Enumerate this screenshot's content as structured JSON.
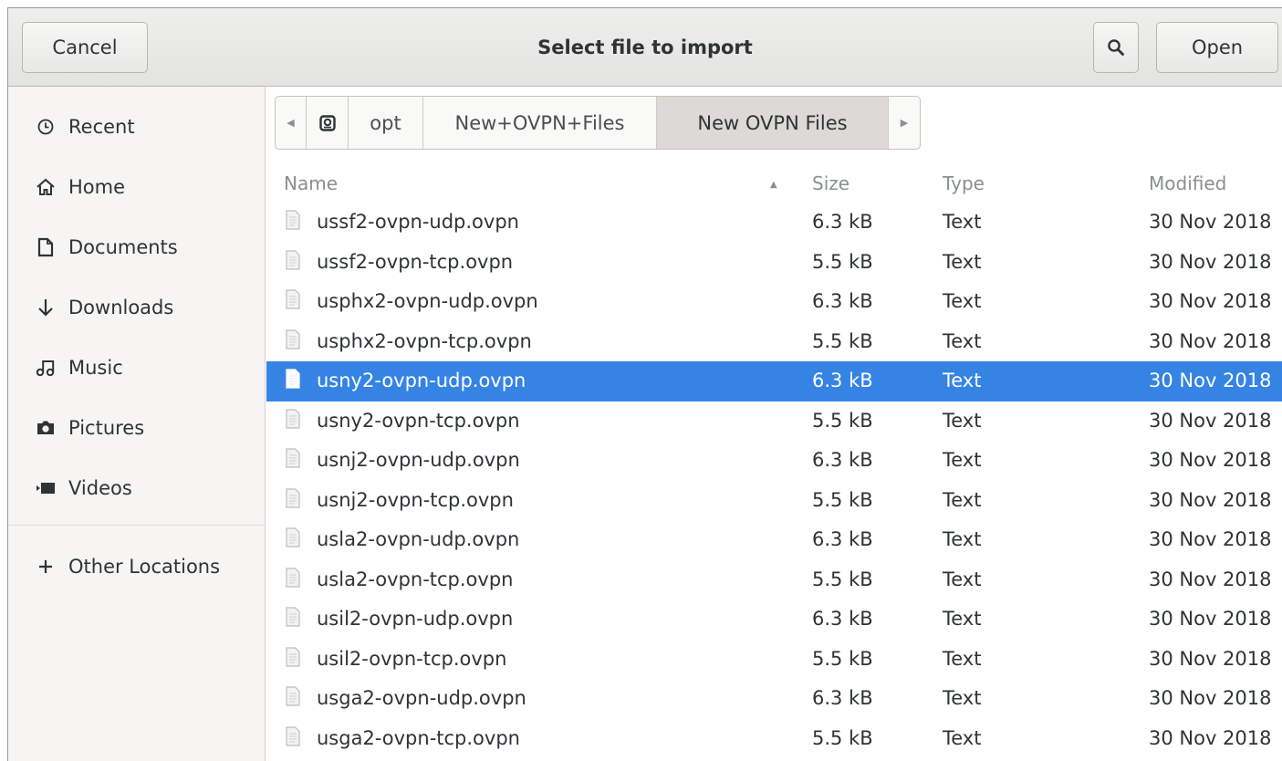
{
  "header": {
    "cancel_label": "Cancel",
    "title": "Select file to import",
    "search_icon": "search-icon",
    "open_label": "Open"
  },
  "sidebar": {
    "items": [
      {
        "label": "Recent",
        "icon": "clock-icon"
      },
      {
        "label": "Home",
        "icon": "home-icon"
      },
      {
        "label": "Documents",
        "icon": "document-icon"
      },
      {
        "label": "Downloads",
        "icon": "download-icon"
      },
      {
        "label": "Music",
        "icon": "music-icon"
      },
      {
        "label": "Pictures",
        "icon": "camera-icon"
      },
      {
        "label": "Videos",
        "icon": "video-icon"
      }
    ],
    "other": {
      "label": "Other Locations",
      "icon": "plus-icon"
    }
  },
  "pathbar": {
    "segments": [
      "opt",
      "New+OVPN+Files",
      "New OVPN Files"
    ],
    "root_icon": "drive-icon"
  },
  "columns": {
    "name": "Name",
    "size": "Size",
    "type": "Type",
    "modified": "Modified"
  },
  "files": [
    {
      "name": "ussf2-ovpn-udp.ovpn",
      "size": "6.3 kB",
      "type": "Text",
      "modified": "30 Nov 2018"
    },
    {
      "name": "ussf2-ovpn-tcp.ovpn",
      "size": "5.5 kB",
      "type": "Text",
      "modified": "30 Nov 2018"
    },
    {
      "name": "usphx2-ovpn-udp.ovpn",
      "size": "6.3 kB",
      "type": "Text",
      "modified": "30 Nov 2018"
    },
    {
      "name": "usphx2-ovpn-tcp.ovpn",
      "size": "5.5 kB",
      "type": "Text",
      "modified": "30 Nov 2018"
    },
    {
      "name": "usny2-ovpn-udp.ovpn",
      "size": "6.3 kB",
      "type": "Text",
      "modified": "30 Nov 2018"
    },
    {
      "name": "usny2-ovpn-tcp.ovpn",
      "size": "5.5 kB",
      "type": "Text",
      "modified": "30 Nov 2018"
    },
    {
      "name": "usnj2-ovpn-udp.ovpn",
      "size": "6.3 kB",
      "type": "Text",
      "modified": "30 Nov 2018"
    },
    {
      "name": "usnj2-ovpn-tcp.ovpn",
      "size": "5.5 kB",
      "type": "Text",
      "modified": "30 Nov 2018"
    },
    {
      "name": "usla2-ovpn-udp.ovpn",
      "size": "6.3 kB",
      "type": "Text",
      "modified": "30 Nov 2018"
    },
    {
      "name": "usla2-ovpn-tcp.ovpn",
      "size": "5.5 kB",
      "type": "Text",
      "modified": "30 Nov 2018"
    },
    {
      "name": "usil2-ovpn-udp.ovpn",
      "size": "6.3 kB",
      "type": "Text",
      "modified": "30 Nov 2018"
    },
    {
      "name": "usil2-ovpn-tcp.ovpn",
      "size": "5.5 kB",
      "type": "Text",
      "modified": "30 Nov 2018"
    },
    {
      "name": "usga2-ovpn-udp.ovpn",
      "size": "6.3 kB",
      "type": "Text",
      "modified": "30 Nov 2018"
    },
    {
      "name": "usga2-ovpn-tcp.ovpn",
      "size": "5.5 kB",
      "type": "Text",
      "modified": "30 Nov 2018"
    }
  ],
  "selected_file": "usny2-ovpn-udp.ovpn",
  "colors": {
    "selection": "#3584e4",
    "headerbar": "#e8e8e7",
    "sidebar": "#f6f5f4"
  }
}
